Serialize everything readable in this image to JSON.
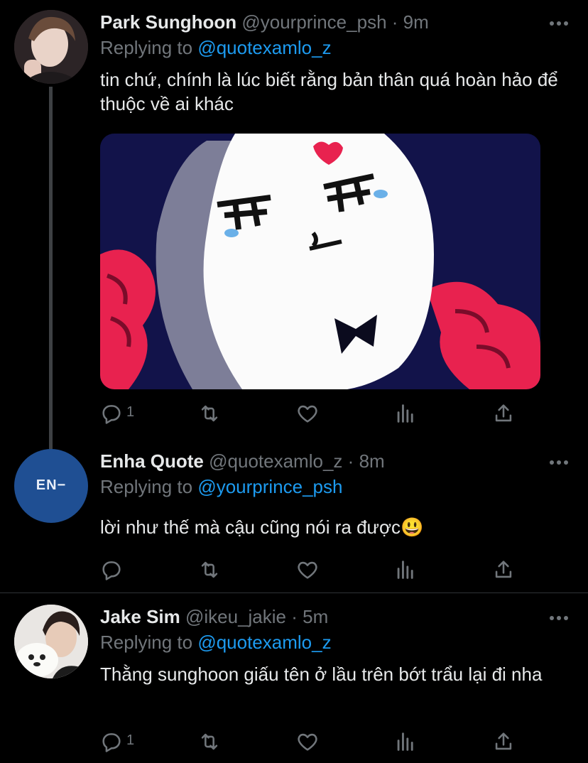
{
  "colors": {
    "background": "#000000",
    "text": "#e7e9ea",
    "muted": "#71767b",
    "link": "#1d9bf0",
    "thread_line": "#3e4144"
  },
  "tweets": [
    {
      "name": "Park Sunghoon",
      "handle": "@yourprince_psh",
      "time": "9m",
      "replying_to": "Replying to",
      "mention": "@quotexamlo_z",
      "text": "tin chứ, chính là lúc biết rằng bản thân quá hoàn hảo để thuộc về ai khác",
      "media": "meme-image",
      "reply_count": "1"
    },
    {
      "name": "Enha Quote",
      "handle": "@quotexamlo_z",
      "time": "8m",
      "replying_to": "Replying to",
      "mention": "@yourprince_psh",
      "avatar_text": "EN−",
      "text": "lời như thế mà cậu cũng nói ra được😃",
      "reply_count": ""
    },
    {
      "name": "Jake Sim",
      "handle": "@ikeu_jakie",
      "time": "5m",
      "replying_to": "Replying to",
      "mention": "@quotexamlo_z",
      "text": "Thằng sunghoon giấu tên ở lầu trên bớt trẩu lại đi nha",
      "reply_count": "1"
    }
  ],
  "icons": [
    "reply-icon",
    "retweet-icon",
    "like-icon",
    "analytics-icon",
    "share-icon",
    "more-icon"
  ]
}
